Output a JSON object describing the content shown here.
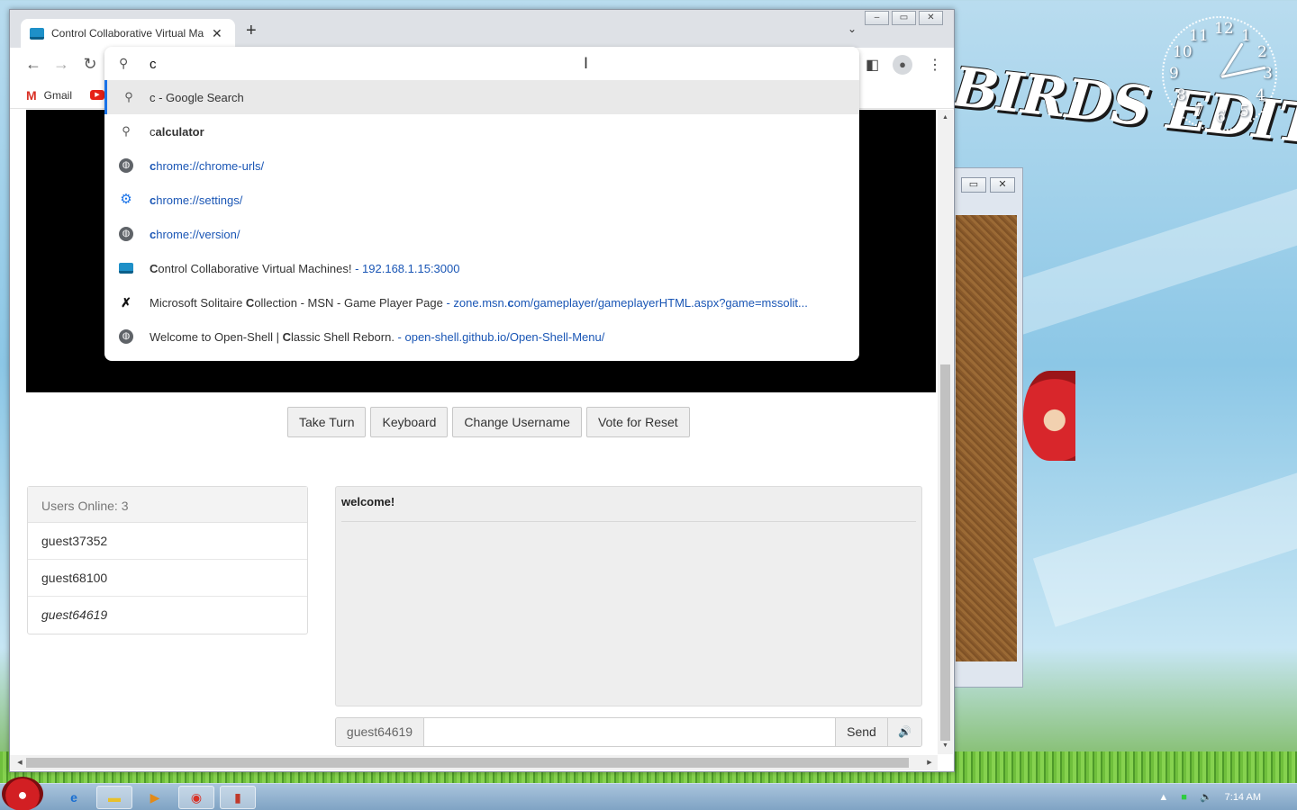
{
  "desktop": {
    "wallpaper_title": "BIRDS EDITION",
    "clock_numbers": [
      "12",
      "1",
      "2",
      "3",
      "4",
      "5",
      "6",
      "7",
      "8",
      "9",
      "10",
      "11"
    ]
  },
  "browser": {
    "tab_title": "Control Collaborative Virtual Ma",
    "tab_close": "✕",
    "new_tab": "+",
    "omnibox": {
      "value": "c",
      "suggestions": [
        {
          "icon": "search-icon",
          "parts": [
            {
              "t": "c",
              "s": "plain"
            },
            {
              "t": " - Google Search",
              "s": "plain"
            }
          ]
        },
        {
          "icon": "search-icon",
          "parts": [
            {
              "t": "c",
              "s": "plain"
            },
            {
              "t": "alculator",
              "s": "bold"
            }
          ]
        },
        {
          "icon": "globe-icon",
          "parts": [
            {
              "t": "c",
              "s": "link-bold"
            },
            {
              "t": "hrome://chrome-urls/",
              "s": "link"
            }
          ]
        },
        {
          "icon": "settings-gear-icon",
          "parts": [
            {
              "t": "c",
              "s": "link-bold"
            },
            {
              "t": "hrome://settings/",
              "s": "link"
            }
          ]
        },
        {
          "icon": "globe-icon",
          "parts": [
            {
              "t": "c",
              "s": "link-bold"
            },
            {
              "t": "hrome://version/",
              "s": "link"
            }
          ]
        },
        {
          "icon": "vm-site-icon",
          "parts": [
            {
              "t": "C",
              "s": "bold"
            },
            {
              "t": "ontrol Collaborative Virtual Machines!",
              "s": "plain"
            },
            {
              "t": " - 192.168.1.15:3000",
              "s": "link"
            }
          ]
        },
        {
          "icon": "msn-icon",
          "parts": [
            {
              "t": "Microsoft Solitaire ",
              "s": "plain"
            },
            {
              "t": "C",
              "s": "bold"
            },
            {
              "t": "ollection - MSN - Game Player Page",
              "s": "plain"
            },
            {
              "t": " - zone.msn.",
              "s": "link"
            },
            {
              "t": "c",
              "s": "link-bold"
            },
            {
              "t": "om/gameplayer/gameplayerHTML.aspx?game=mssolit...",
              "s": "link"
            }
          ]
        },
        {
          "icon": "globe-icon",
          "parts": [
            {
              "t": "Welcome to Open-Shell | ",
              "s": "plain"
            },
            {
              "t": "C",
              "s": "bold"
            },
            {
              "t": "lassic Shell Reborn.",
              "s": "plain"
            },
            {
              "t": " - open-shell.github.io/Open-Shell-Menu/",
              "s": "link"
            }
          ]
        }
      ]
    },
    "bookmarks": [
      {
        "label": "Gmail",
        "icon": "gmail-icon"
      },
      {
        "label": "",
        "icon": "youtube-icon"
      }
    ]
  },
  "page": {
    "buttons": {
      "take_turn": "Take Turn",
      "keyboard": "Keyboard",
      "change_username": "Change Username",
      "vote_reset": "Vote for Reset"
    },
    "users": {
      "header": "Users Online: 3",
      "list": [
        "guest37352",
        "guest68100",
        "guest64619"
      ]
    },
    "chat": {
      "messages": [
        "welcome!"
      ],
      "username": "guest64619",
      "input_value": "",
      "send": "Send"
    }
  },
  "taskbar": {
    "time": "7:14 AM"
  }
}
